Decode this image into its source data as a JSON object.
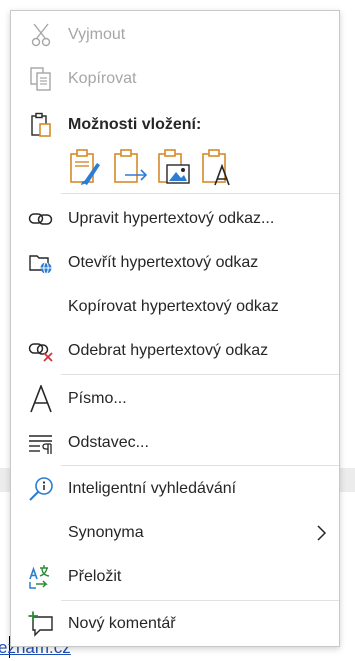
{
  "menu": {
    "cut": "Vyjmout",
    "copy": "Kopírovat",
    "paste_options": "Možnosti vložení:",
    "edit_hyperlink": "Upravit hypertextový odkaz...",
    "open_hyperlink": "Otevřít hypertextový odkaz",
    "copy_hyperlink": "Kopírovat hypertextový odkaz",
    "remove_hyperlink": "Odebrat hypertextový odkaz",
    "font": "Písmo...",
    "paragraph": "Odstavec...",
    "smart_lookup": "Inteligentní vyhledávání",
    "synonyms": "Synonyma",
    "translate": "Přeložit",
    "new_comment": "Nový komentář"
  },
  "document": {
    "link_text": "eznam.cz"
  },
  "colors": {
    "accent_orange": "#d68a2a",
    "accent_blue": "#2b7cd3",
    "accent_green": "#2e8b3a",
    "accent_red": "#d13438"
  },
  "icons": {
    "cut": "scissors-icon",
    "copy": "copy-icon",
    "paste": "clipboard-icon",
    "edit_hyperlink": "link-icon",
    "open_hyperlink": "folder-globe-icon",
    "remove_hyperlink": "link-remove-icon",
    "font": "font-icon",
    "paragraph": "paragraph-icon",
    "smart_lookup": "search-info-icon",
    "synonyms": "chevron-right-icon",
    "translate": "translate-icon",
    "new_comment": "comment-add-icon"
  }
}
